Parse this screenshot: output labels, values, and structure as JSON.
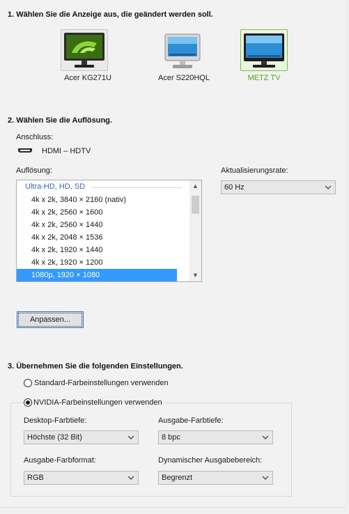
{
  "step1": {
    "heading": "1. Wählen Sie die Anzeige aus, die geändert werden soll."
  },
  "displays": [
    {
      "name": "Acer KG271U",
      "icon": "monitor-nvidia-icon"
    },
    {
      "name": "Acer S220HQL",
      "icon": "monitor-icon"
    },
    {
      "name": "METZ TV",
      "icon": "tv-monitor-icon"
    }
  ],
  "step2": {
    "heading": "2. Wählen Sie die Auflösung.",
    "connection_label": "Anschluss:",
    "connection_value": "HDMI – HDTV",
    "resolution_label": "Auflösung:",
    "resolution_group": "Ultra-HD, HD, SD",
    "resolutions": [
      "4k x 2k, 3840 × 2160 (nativ)",
      "4k x 2k, 2560 × 1600",
      "4k x 2k, 2560 × 1440",
      "4k x 2k, 2048 × 1536",
      "4k x 2k, 1920 × 1440",
      "4k x 2k, 1920 × 1200",
      "1080p, 1920 × 1080"
    ],
    "refresh_label": "Aktualisierungsrate:",
    "refresh_value": "60 Hz",
    "customize_button": "Anpassen..."
  },
  "step3": {
    "heading": "3. Übernehmen Sie die folgenden Einstellungen.",
    "radio_default": "Standard-Farbeinstellungen verwenden",
    "radio_nvidia": "NVIDIA-Farbeinstellungen verwenden",
    "desktop_depth_label": "Desktop-Farbtiefe:",
    "desktop_depth_value": "Höchste (32 Bit)",
    "output_depth_label": "Ausgabe-Farbtiefe:",
    "output_depth_value": "8 bpc",
    "output_format_label": "Ausgabe-Farbformat:",
    "output_format_value": "RGB",
    "dynamic_range_label": "Dynamischer Ausgabebereich:",
    "dynamic_range_value": "Begrenzt"
  },
  "colors": {
    "accent_green": "#76b900",
    "selection_blue": "#3399ff",
    "group_blue": "#3b66a8"
  }
}
